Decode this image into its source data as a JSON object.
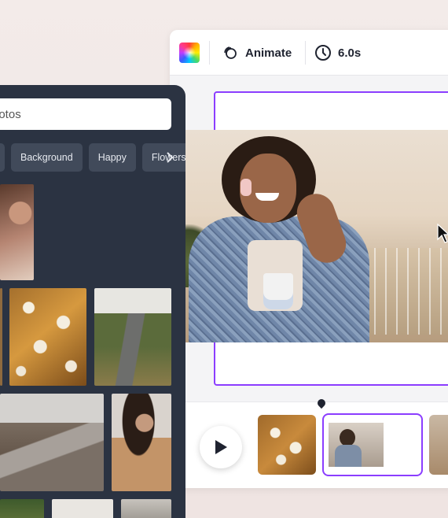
{
  "toolbar": {
    "animate_label": "Animate",
    "duration_label": "6.0s"
  },
  "panel": {
    "search_value": "hotos",
    "chips": [
      "Background",
      "Happy",
      "Flowers"
    ]
  },
  "icons": {
    "color": "color-swatch-icon",
    "animate": "animate-icon",
    "clock": "clock-icon",
    "play": "play-icon",
    "chevron": "chevron-right-icon",
    "cursor": "mouse-pointer-icon"
  },
  "colors": {
    "accent": "#8b3dff",
    "panel_bg": "#2b3342",
    "chip_bg": "#414a5a"
  }
}
